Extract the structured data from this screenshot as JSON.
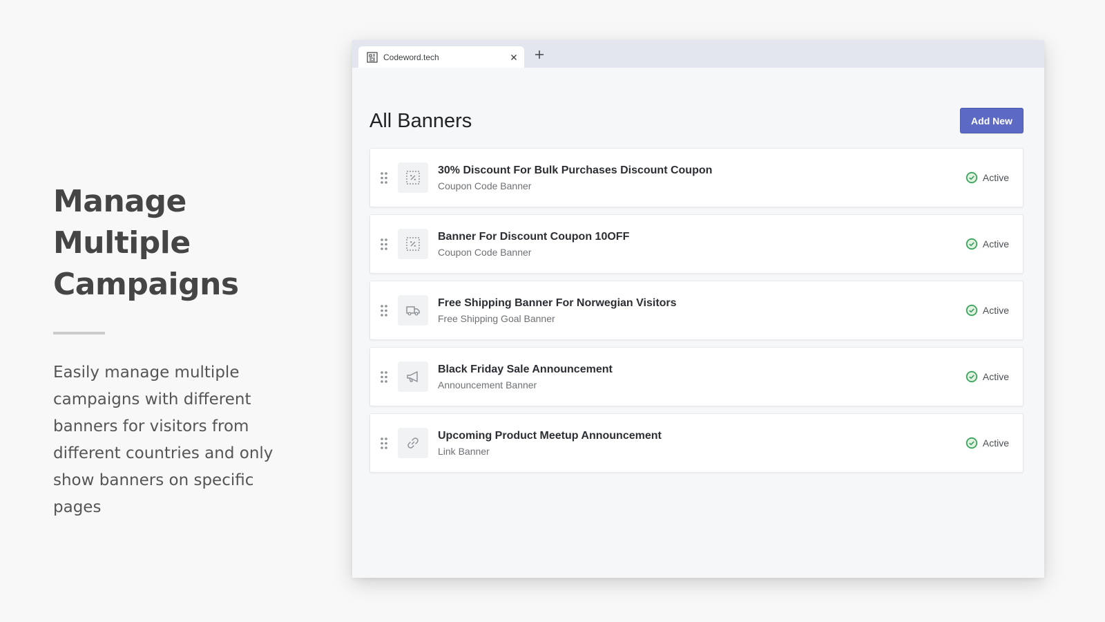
{
  "intro": {
    "heading_line1": "Manage Multiple",
    "heading_line2": "Campaigns",
    "description": "Easily manage multiple campaigns with different banners for visitors from different countries and only show banners on specific pages"
  },
  "browser": {
    "tab_title": "Codeword.tech"
  },
  "page": {
    "title": "All Banners",
    "add_button_label": "Add New"
  },
  "banners": [
    {
      "title": "30% Discount For Bulk Purchases Discount Coupon",
      "type": "Coupon Code Banner",
      "icon": "coupon-icon",
      "status": "Active"
    },
    {
      "title": "Banner For Discount Coupon 10OFF",
      "type": "Coupon Code Banner",
      "icon": "coupon-icon",
      "status": "Active"
    },
    {
      "title": "Free Shipping Banner For Norwegian Visitors",
      "type": "Free Shipping Goal Banner",
      "icon": "truck-icon",
      "status": "Active"
    },
    {
      "title": "Black Friday Sale Announcement",
      "type": "Announcement Banner",
      "icon": "megaphone-icon",
      "status": "Active"
    },
    {
      "title": "Upcoming Product Meetup Announcement",
      "type": "Link Banner",
      "icon": "link-icon",
      "status": "Active"
    }
  ],
  "colors": {
    "accent": "#5c6ac4",
    "status_ok": "#2e9e5b"
  }
}
